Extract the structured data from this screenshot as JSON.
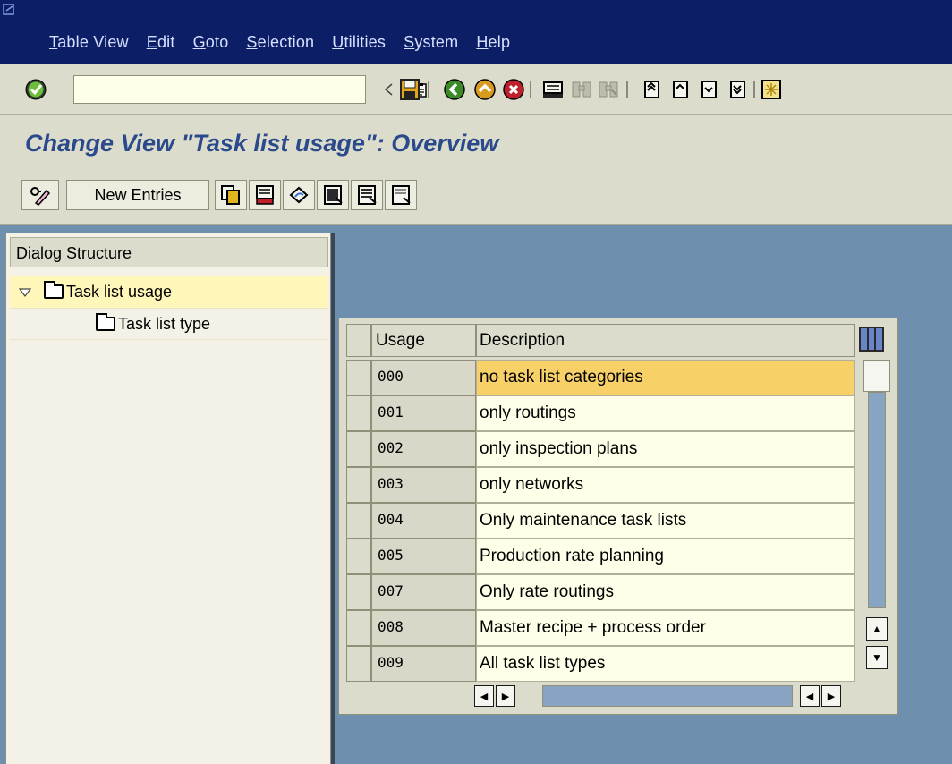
{
  "menubar": {
    "items": [
      {
        "pre": "",
        "u": "T",
        "post": "able View"
      },
      {
        "pre": "",
        "u": "E",
        "post": "dit"
      },
      {
        "pre": "",
        "u": "G",
        "post": "oto"
      },
      {
        "pre": "",
        "u": "S",
        "post": "election"
      },
      {
        "pre": "",
        "u": "U",
        "post": "tilities"
      },
      {
        "pre": "",
        "u": "S",
        "post": "ystem"
      },
      {
        "pre": "",
        "u": "H",
        "post": "elp"
      }
    ]
  },
  "toolbar": {
    "command_value": "",
    "icons": [
      "enter-icon",
      "history-icon",
      "back-arrow-icon",
      "save-icon",
      "back-icon",
      "exit-icon",
      "cancel-icon",
      "print-icon",
      "find-icon",
      "find-next-icon",
      "first-page-icon",
      "previous-page-icon",
      "next-page-icon",
      "last-page-icon",
      "create-session-icon"
    ]
  },
  "title": "Change View \"Task list usage\": Overview",
  "app_toolbar": {
    "new_entries_label": "New Entries"
  },
  "dialog_structure": {
    "header": "Dialog Structure",
    "items": [
      {
        "label": "Task list usage",
        "level": 1,
        "expanded": true,
        "selected": true
      },
      {
        "label": "Task list type",
        "level": 2,
        "expanded": false,
        "selected": false
      }
    ]
  },
  "table": {
    "columns": [
      "Usage",
      "Description"
    ],
    "rows": [
      {
        "usage": "000",
        "description": "no task list categories",
        "active": true
      },
      {
        "usage": "001",
        "description": "only routings",
        "active": false
      },
      {
        "usage": "002",
        "description": "only inspection plans",
        "active": false
      },
      {
        "usage": "003",
        "description": "only networks",
        "active": false
      },
      {
        "usage": "004",
        "description": "Only maintenance task lists",
        "active": false
      },
      {
        "usage": "005",
        "description": "Production rate planning",
        "active": false
      },
      {
        "usage": "007",
        "description": "Only rate routings",
        "active": false
      },
      {
        "usage": "008",
        "description": "Master recipe + process order",
        "active": false
      },
      {
        "usage": "009",
        "description": "All task list types",
        "active": false
      }
    ]
  },
  "colors": {
    "menubar_bg": "#0b1e66",
    "toolbar_bg": "#dcdccc",
    "title_color": "#2a4a8c",
    "active_cell": "#f7d068",
    "selected_tree": "#fff7b9",
    "workspace_bg": "#6f8fae"
  }
}
